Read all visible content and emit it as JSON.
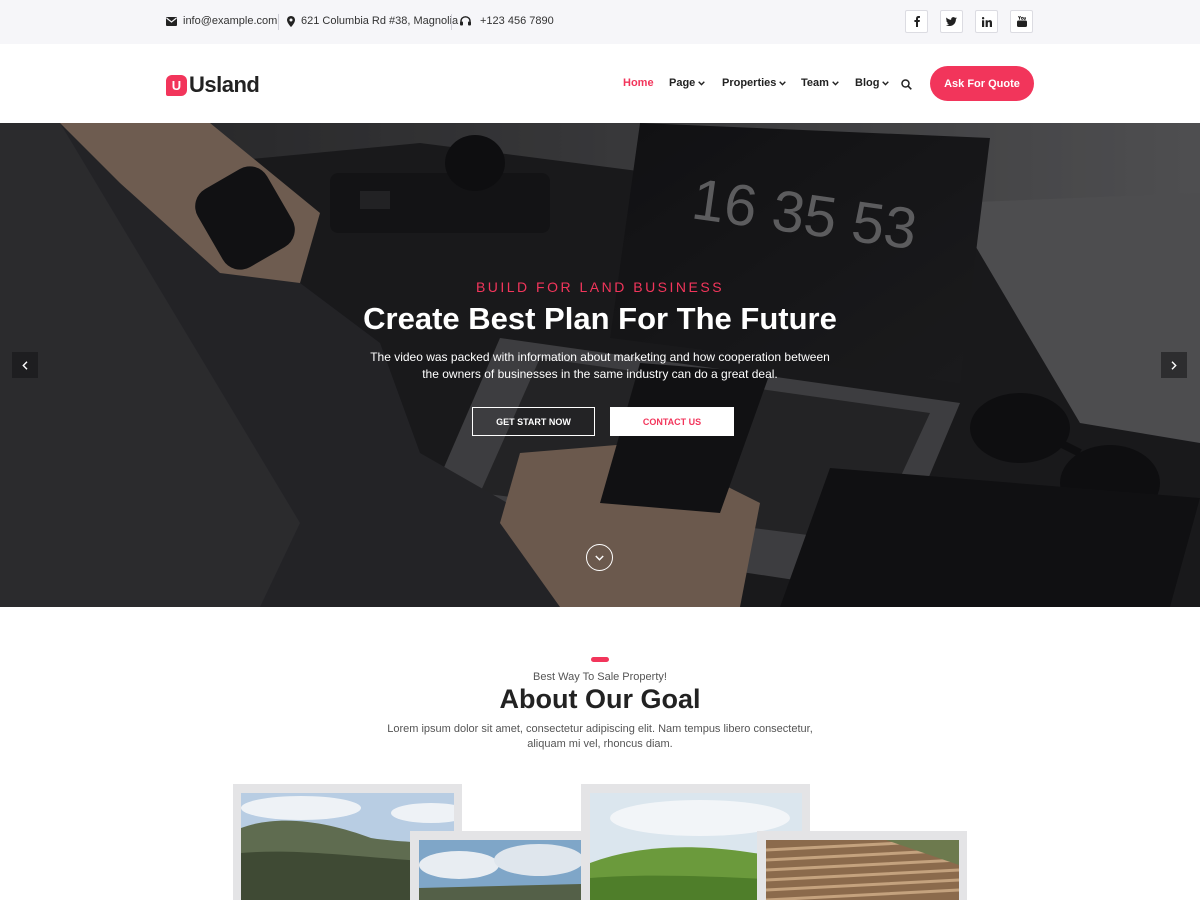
{
  "topbar": {
    "email": "info@example.com",
    "address": "621 Columbia Rd #38, Magnolia",
    "phone": "+123 456 7890",
    "social": [
      {
        "icon": "facebook-icon",
        "glyph": "f"
      },
      {
        "icon": "twitter-icon",
        "glyph": "t"
      },
      {
        "icon": "linkedin-icon",
        "glyph": "in"
      },
      {
        "icon": "youtube-icon",
        "glyph": "yt"
      }
    ]
  },
  "header": {
    "logo_mark": "U",
    "logo_text": "Usland",
    "nav": [
      "Home",
      "Page",
      "Properties",
      "Team",
      "Blog"
    ],
    "quote_label": "Ask For Quote"
  },
  "hero": {
    "eyebrow": "BUILD FOR LAND BUSINESS",
    "title": "Create Best Plan For The Future",
    "description": "The video was packed with information about marketing and how cooperation between the owners of businesses in the same industry can do a great deal.",
    "primary_button": "GET START NOW",
    "secondary_button": "CONTACT US",
    "laptop_clock": "16 35 53"
  },
  "about": {
    "subtitle": "Best Way To Sale Property!",
    "title": "About Our Goal",
    "description": "Lorem ipsum dolor sit amet, consectetur adipiscing elit. Nam tempus libero consectetur, aliquam mi vel, rhoncus diam."
  },
  "colors": {
    "accent": "#f2355b",
    "topbar_bg": "#f6f6f9",
    "text_dark": "#222222"
  }
}
